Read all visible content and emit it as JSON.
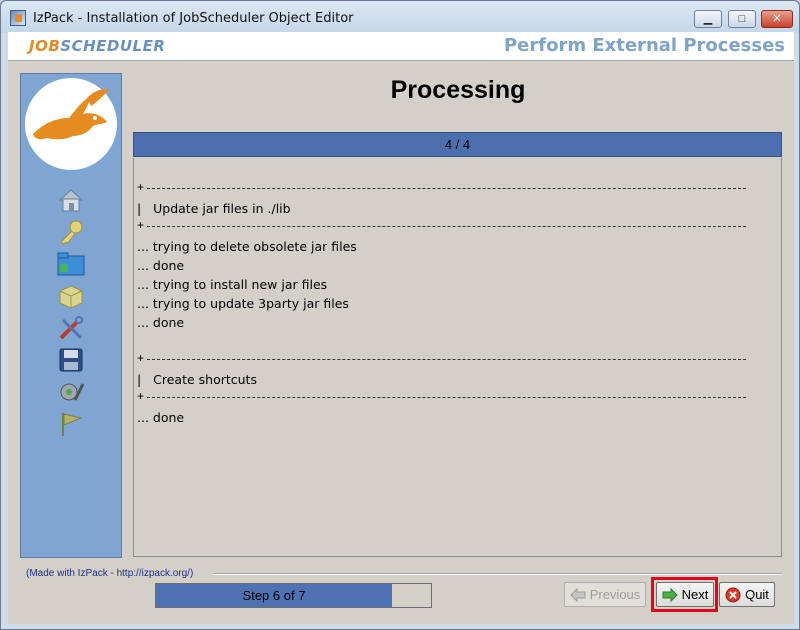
{
  "window": {
    "title": "IzPack - Installation of JobScheduler Object Editor",
    "minimize_glyph": "▁",
    "maximize_glyph": "□",
    "close_glyph": "✕"
  },
  "header": {
    "logo_part1": "JOB",
    "logo_part2": "SCHEDULER",
    "panel_title": "Perform External Processes"
  },
  "sidebar": {
    "icons": [
      "home-icon",
      "key-icon",
      "folder-icon",
      "package-icon",
      "tools-icon",
      "floppy-disk-icon",
      "gear-icon",
      "flag-icon"
    ]
  },
  "main": {
    "title": "Processing",
    "progress_text": "4 / 4",
    "log": {
      "section1_title": "|   Update jar files in ./lib",
      "line1": "... trying to delete obsolete jar files",
      "line2": "... done",
      "line3": "... trying to install new jar files",
      "line4": "... trying to update 3party jar files",
      "line5": "... done",
      "section2_title": "|   Create shortcuts",
      "line6": "... done"
    }
  },
  "footer": {
    "made_with": "(Made with IzPack - http://izpack.org/)",
    "step_text": "Step 6 of 7",
    "step_progress": 0.857,
    "previous_label": "Previous",
    "next_label": "Next",
    "quit_label": "Quit"
  },
  "colors": {
    "progress_blue": "#4e6fae",
    "sidebar_blue": "#7fa5d3",
    "highlight_red": "#e8001c",
    "logo_orange": "#e58b1f"
  }
}
